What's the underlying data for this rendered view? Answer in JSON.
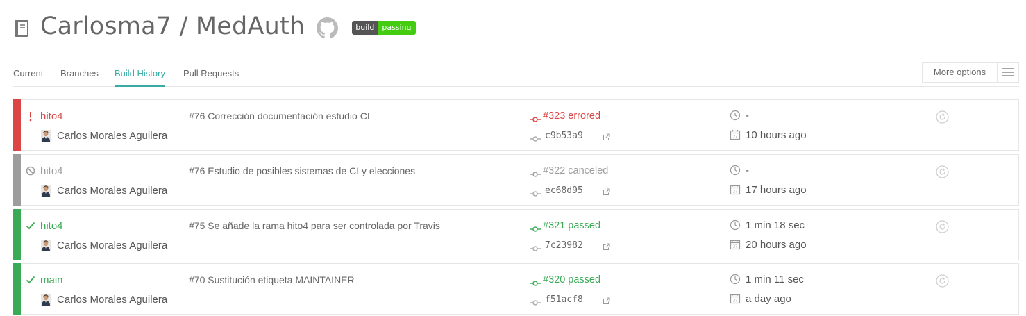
{
  "header": {
    "title": "Carlosma7 / MedAuth",
    "repo_icon": "repo-book-icon",
    "github_icon": "github-icon",
    "badge": {
      "left": "build",
      "right": "passing",
      "left_color": "#555555",
      "right_color": "#44cc11"
    }
  },
  "tabs": [
    {
      "label": "Current",
      "active": false
    },
    {
      "label": "Branches",
      "active": false
    },
    {
      "label": "Build History",
      "active": true
    },
    {
      "label": "Pull Requests",
      "active": false
    }
  ],
  "more_options": {
    "label": "More options",
    "icon": "hamburger-icon"
  },
  "colors": {
    "errored": "#db4545",
    "canceled": "#9d9d9d",
    "passed": "#39aa56",
    "accent": "#39aaa4"
  },
  "builds": [
    {
      "state": "errored",
      "branch": "hito4",
      "author": "Carlos Morales Aguilera",
      "message": "#76 Corrección documentación estudio CI",
      "build": "#323 errored",
      "sha": "c9b53a9",
      "duration": "-",
      "finished": "10 hours ago"
    },
    {
      "state": "canceled",
      "branch": "hito4",
      "author": "Carlos Morales Aguilera",
      "message": "#76 Estudio de posibles sistemas de CI y elecciones",
      "build": "#322 canceled",
      "sha": "ec68d95",
      "duration": "-",
      "finished": "17 hours ago"
    },
    {
      "state": "passed",
      "branch": "hito4",
      "author": "Carlos Morales Aguilera",
      "message": "#75 Se añade la rama hito4 para ser controlada por Travis",
      "build": "#321 passed",
      "sha": "7c23982",
      "duration": "1 min 18 sec",
      "finished": "20 hours ago"
    },
    {
      "state": "passed",
      "branch": "main",
      "author": "Carlos Morales Aguilera",
      "message": "#70 Sustitución etiqueta MAINTAINER",
      "build": "#320 passed",
      "sha": "f51acf8",
      "duration": "1 min 11 sec",
      "finished": "a day ago"
    }
  ]
}
